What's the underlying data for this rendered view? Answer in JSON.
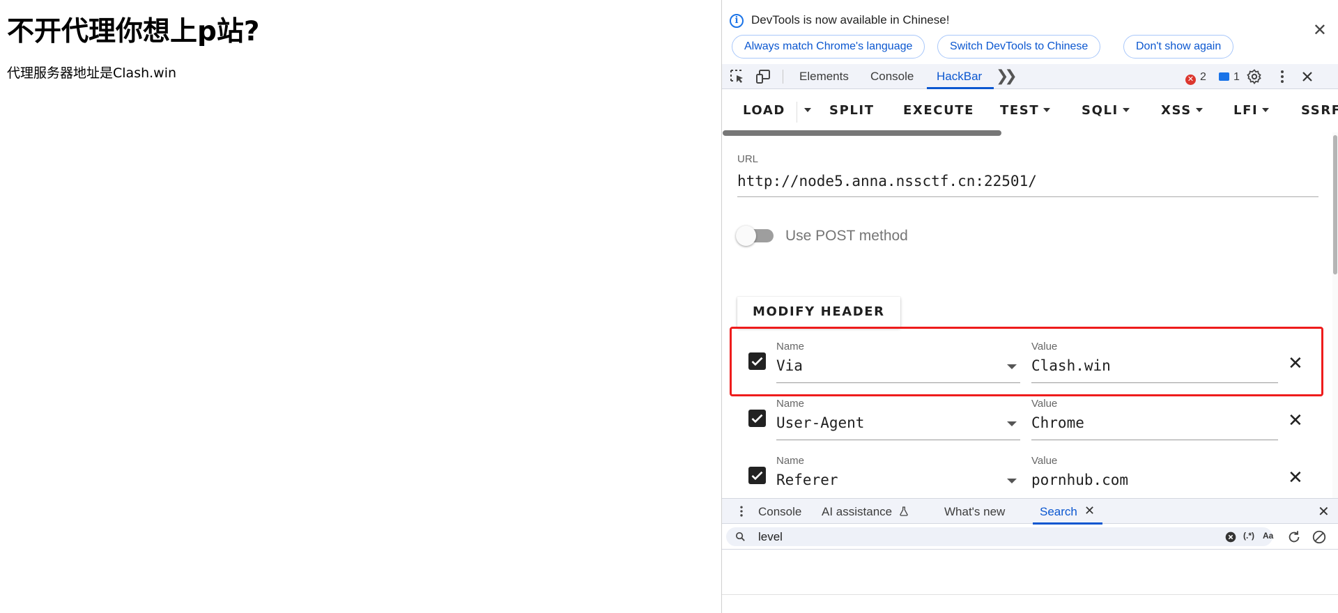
{
  "page": {
    "heading": "不开代理你想上p站?",
    "text": "代理服务器地址是Clash.win"
  },
  "devtools": {
    "infobar": {
      "message": "DevTools is now available in Chinese!",
      "buttons": [
        "Always match Chrome's language",
        "Switch DevTools to Chinese",
        "Don't show again"
      ],
      "close_icon": "close-icon"
    },
    "tabs": [
      "Elements",
      "Console",
      "HackBar"
    ],
    "active_tab": "HackBar",
    "more_tabs_icon": "chevrons-right-icon",
    "errors": "2",
    "messages": "1",
    "toolbar_icons": [
      "inspect-element-icon",
      "device-toolbar-icon",
      "settings-icon",
      "kebab-menu-icon",
      "close-icon"
    ]
  },
  "hackbar": {
    "toolbar": [
      "LOAD",
      "SPLIT",
      "EXECUTE",
      "TEST",
      "SQLI",
      "XSS",
      "LFI",
      "SSRF"
    ],
    "url_label": "URL",
    "url_value": "http://node5.anna.nssctf.cn:22501/",
    "post_label": "Use POST method",
    "post_enabled": false,
    "modify_header_label": "MODIFY HEADER",
    "headers": [
      {
        "name_label": "Name",
        "name": "Via",
        "value_label": "Value",
        "value": "Clash.win",
        "checked": true
      },
      {
        "name_label": "Name",
        "name": "User-Agent",
        "value_label": "Value",
        "value": "Chrome",
        "checked": true
      },
      {
        "name_label": "Name",
        "name": "Referer",
        "value_label": "Value",
        "value": "pornhub.com",
        "checked": true
      }
    ],
    "highlight_color": "#ee1c1c"
  },
  "drawer": {
    "tabs": [
      "Console",
      "AI assistance",
      "What's new",
      "Search"
    ],
    "active_tab": "Search",
    "search_value": "level",
    "regex_label": "(.*)",
    "case_label": "Aa"
  },
  "colors": {
    "accent": "#0b57d0",
    "error": "#dc362e",
    "tabbar_bg": "#f1f3f9"
  }
}
